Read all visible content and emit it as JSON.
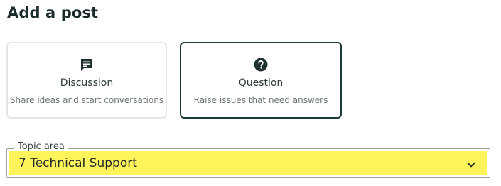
{
  "header": {
    "title": "Add a post"
  },
  "post_types": [
    {
      "icon": "chat-bubble-icon",
      "label": "Discussion",
      "description": "Share ideas and start conversations",
      "selected": false
    },
    {
      "icon": "question-circle-icon",
      "label": "Question",
      "description": "Raise issues that need answers",
      "selected": true
    }
  ],
  "topic": {
    "legend": "Topic area",
    "value": "7 Technical Support",
    "icon": "chevron-down-icon"
  },
  "colors": {
    "selected_border": "#1e3b3a",
    "highlight": "#fdf35a",
    "text_primary": "#1b2b2b"
  }
}
